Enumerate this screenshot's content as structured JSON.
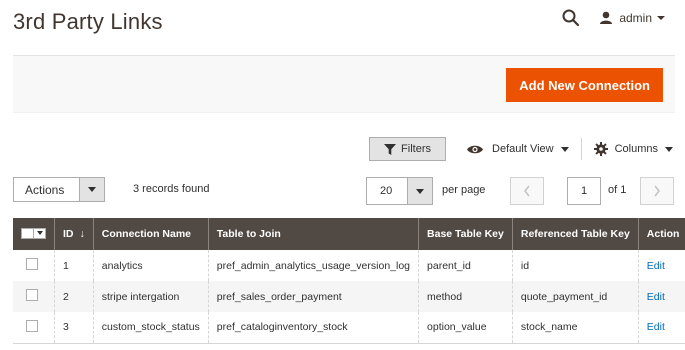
{
  "page": {
    "title": "3rd Party Links"
  },
  "header": {
    "user_name": "admin"
  },
  "actions": {
    "add_button": "Add New Connection"
  },
  "toolbar": {
    "filters_label": "Filters",
    "view_label": "Default View",
    "columns_label": "Columns",
    "mass_actions_label": "Actions",
    "records_found": "3 records found",
    "per_page_value": "20",
    "per_page_label": "per page",
    "current_page": "1",
    "page_of": "of 1"
  },
  "table": {
    "columns": [
      "ID",
      "Connection Name",
      "Table to Join",
      "Base Table Key",
      "Referenced Table Key",
      "Action"
    ],
    "rows": [
      {
        "id": "1",
        "name": "analytics",
        "table": "pref_admin_analytics_usage_version_log",
        "base_key": "parent_id",
        "ref_key": "id",
        "action": "Edit"
      },
      {
        "id": "2",
        "name": "stripe intergation",
        "table": "pref_sales_order_payment",
        "base_key": "method",
        "ref_key": "quote_payment_id",
        "action": "Edit"
      },
      {
        "id": "3",
        "name": "custom_stock_status",
        "table": "pref_cataloginventory_stock",
        "base_key": "option_value",
        "ref_key": "stock_name",
        "action": "Edit"
      }
    ]
  },
  "icons": {
    "search": "search-icon",
    "user": "user-icon",
    "filter": "filter-icon",
    "view": "eye-icon",
    "columns": "gear-icon",
    "prev": "chevron-left-icon",
    "next": "chevron-right-icon"
  },
  "colors": {
    "accent": "#eb5202",
    "table_header": "#514943",
    "link": "#006bb4"
  }
}
